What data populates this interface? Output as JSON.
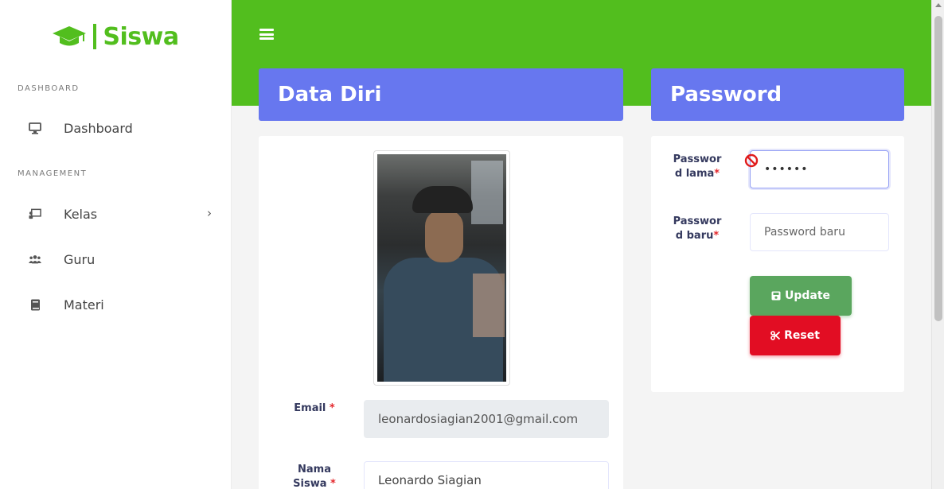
{
  "sidebar": {
    "brand": "Siswa",
    "sections": [
      "DASHBOARD",
      "MANAGEMENT"
    ],
    "items": [
      {
        "label": "Dashboard",
        "icon": "monitor-icon"
      },
      {
        "label": "Kelas",
        "icon": "chalkboard-icon"
      },
      {
        "label": "Guru",
        "icon": "users-icon"
      },
      {
        "label": "Materi",
        "icon": "book-icon"
      }
    ]
  },
  "cards": {
    "data_diri": "Data Diri",
    "password": "Password"
  },
  "profile": {
    "email_label": "Email",
    "email_value": "leonardosiagian2001@gmail.com",
    "name_label_line1": "Nama",
    "name_label_line2": "Siswa",
    "name_value": "Leonardo Siagian"
  },
  "password_form": {
    "old_label_line1": "Passwor",
    "old_label_line2": "d lama",
    "old_value": "••••••",
    "new_label_line1": "Passwor",
    "new_label_line2": "d baru",
    "new_placeholder": "Password baru",
    "update_label": "Update",
    "reset_label": "Reset"
  },
  "colors": {
    "brand_green": "#52be1e",
    "header_blue": "#6777ef",
    "update_green": "#5aa65e",
    "reset_red": "#e20d23"
  }
}
